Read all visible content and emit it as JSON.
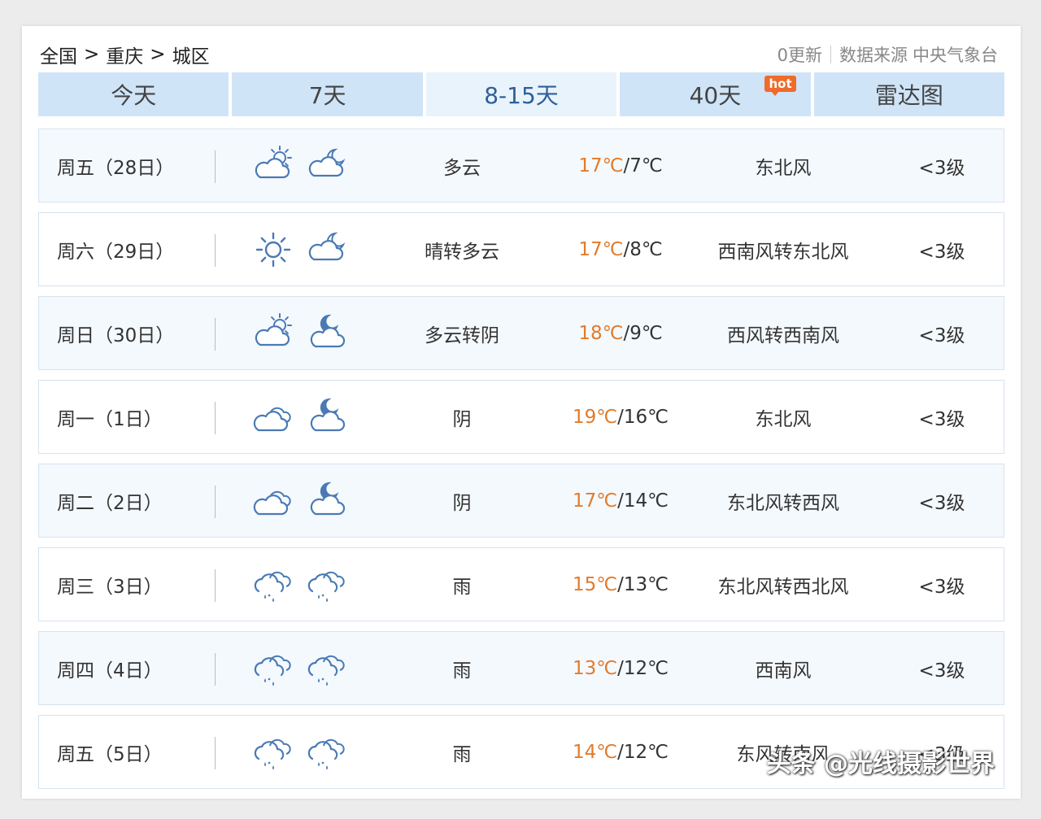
{
  "breadcrumb": {
    "items": [
      "全国",
      "重庆",
      "城区"
    ],
    "separator": ">"
  },
  "topright": {
    "updates": "0更新",
    "source_label": "数据来源",
    "source": "中央气象台"
  },
  "tabs": [
    {
      "label": "今天"
    },
    {
      "label": "7天"
    },
    {
      "label": "8-15天"
    },
    {
      "label": "40天",
      "badge": "hot"
    },
    {
      "label": "雷达图"
    }
  ],
  "active_tab": "8-15天",
  "colors": {
    "tab_bg": "#cfe4f7",
    "tab_active_text": "#2f5f9b",
    "temp_high": "#e27b2b",
    "hot_badge": "#f06a2a",
    "icon_stroke": "#4a7ab5"
  },
  "forecast": [
    {
      "day": "周五（28日）",
      "day_icon": "cloudy-sun-icon",
      "night_icon": "cloudy-moon-icon",
      "desc": "多云",
      "high": "17℃",
      "low": "7℃",
      "wind": "东北风",
      "level": "<3级"
    },
    {
      "day": "周六（29日）",
      "day_icon": "sun-icon",
      "night_icon": "cloudy-moon-icon",
      "desc": "晴转多云",
      "high": "17℃",
      "low": "8℃",
      "wind": "西南风转东北风",
      "level": "<3级"
    },
    {
      "day": "周日（30日）",
      "day_icon": "cloudy-sun-icon",
      "night_icon": "overcast-moon-icon",
      "desc": "多云转阴",
      "high": "18℃",
      "low": "9℃",
      "wind": "西风转西南风",
      "level": "<3级"
    },
    {
      "day": "周一（1日）",
      "day_icon": "overcast-icon",
      "night_icon": "overcast-moon-icon",
      "desc": "阴",
      "high": "19℃",
      "low": "16℃",
      "wind": "东北风",
      "level": "<3级"
    },
    {
      "day": "周二（2日）",
      "day_icon": "overcast-icon",
      "night_icon": "overcast-moon-icon",
      "desc": "阴",
      "high": "17℃",
      "low": "14℃",
      "wind": "东北风转西风",
      "level": "<3级"
    },
    {
      "day": "周三（3日）",
      "day_icon": "rain-icon",
      "night_icon": "rain-icon",
      "desc": "雨",
      "high": "15℃",
      "low": "13℃",
      "wind": "东北风转西北风",
      "level": "<3级"
    },
    {
      "day": "周四（4日）",
      "day_icon": "rain-icon",
      "night_icon": "rain-icon",
      "desc": "雨",
      "high": "13℃",
      "low": "12℃",
      "wind": "西南风",
      "level": "<3级"
    },
    {
      "day": "周五（5日）",
      "day_icon": "rain-icon",
      "night_icon": "rain-icon",
      "desc": "雨",
      "high": "14℃",
      "low": "12℃",
      "wind": "东风转南风",
      "level": "<3级"
    }
  ],
  "watermark": "头条 @光线摄影世界"
}
